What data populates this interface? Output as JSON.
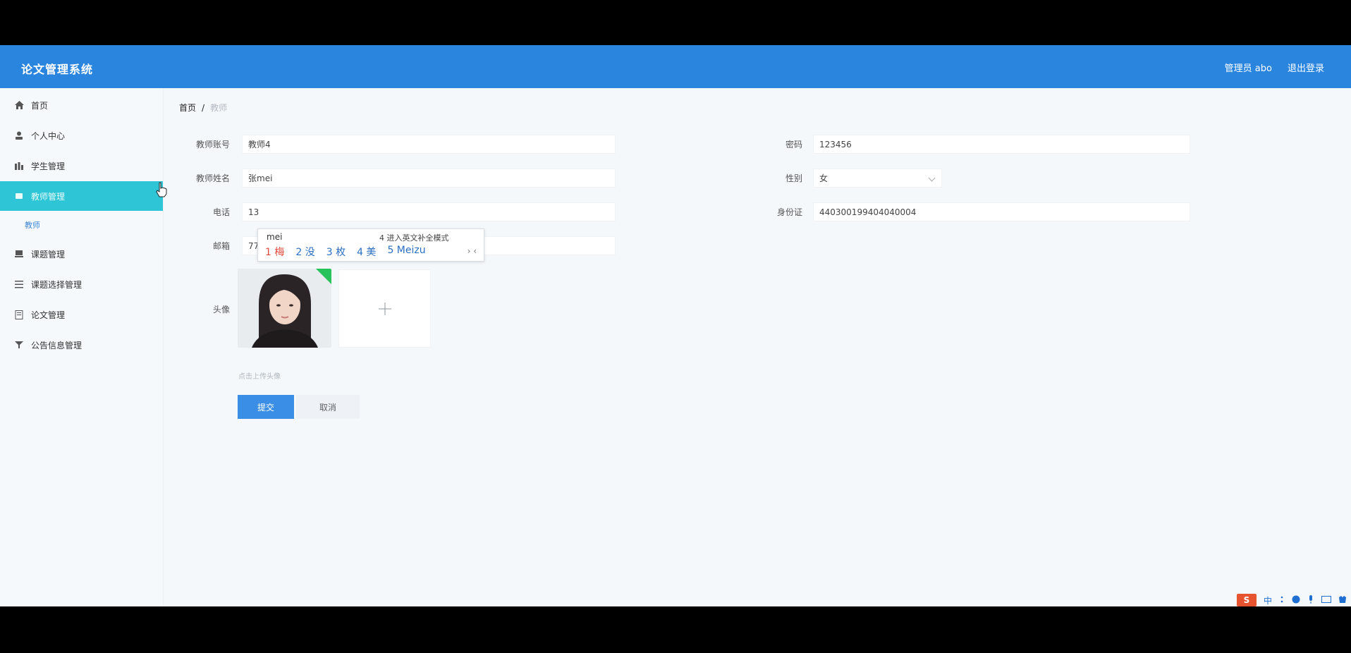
{
  "header": {
    "title": "论文管理系统",
    "user": "管理员 abo",
    "logout": "退出登录"
  },
  "sidebar": {
    "items": [
      {
        "label": "首页",
        "icon": "home-icon"
      },
      {
        "label": "个人中心",
        "icon": "user-icon"
      },
      {
        "label": "学生管理",
        "icon": "chart-icon"
      },
      {
        "label": "教师管理",
        "icon": "teacher-icon",
        "active": true
      },
      {
        "label": "课题管理",
        "icon": "topic-icon"
      },
      {
        "label": "课题选择管理",
        "icon": "list-icon"
      },
      {
        "label": "论文管理",
        "icon": "document-icon"
      },
      {
        "label": "公告信息管理",
        "icon": "notice-icon"
      }
    ],
    "submenu": {
      "label": "教师"
    }
  },
  "breadcrumb": {
    "home": "首页",
    "separator": "/",
    "current": "教师"
  },
  "form": {
    "account_label": "教师账号",
    "account_value": "教师4",
    "password_label": "密码",
    "password_value": "123456",
    "name_label": "教师姓名",
    "name_value": "张mei",
    "gender_label": "性别",
    "gender_value": "女",
    "phone_label": "电话",
    "phone_value": "13",
    "idcard_label": "身份证",
    "idcard_value": "440300199404040004",
    "email_label": "邮箱",
    "email_value": "773890004@qq.com",
    "avatar_label": "头像",
    "upload_tip": "点击上传头像",
    "submit_label": "提交",
    "cancel_label": "取消"
  },
  "ime": {
    "input": "mei",
    "hint": "4 进入英文补全模式",
    "candidates": [
      "1 梅",
      "2 没",
      "3 枚",
      "4 美",
      "5 Meizu"
    ],
    "nav": "› ‹"
  },
  "tray": {
    "sogou": "S",
    "lang": "中"
  },
  "colors": {
    "header": "#2a85df",
    "active_menu": "#2ec6d6",
    "primary": "#3a8ee6"
  }
}
